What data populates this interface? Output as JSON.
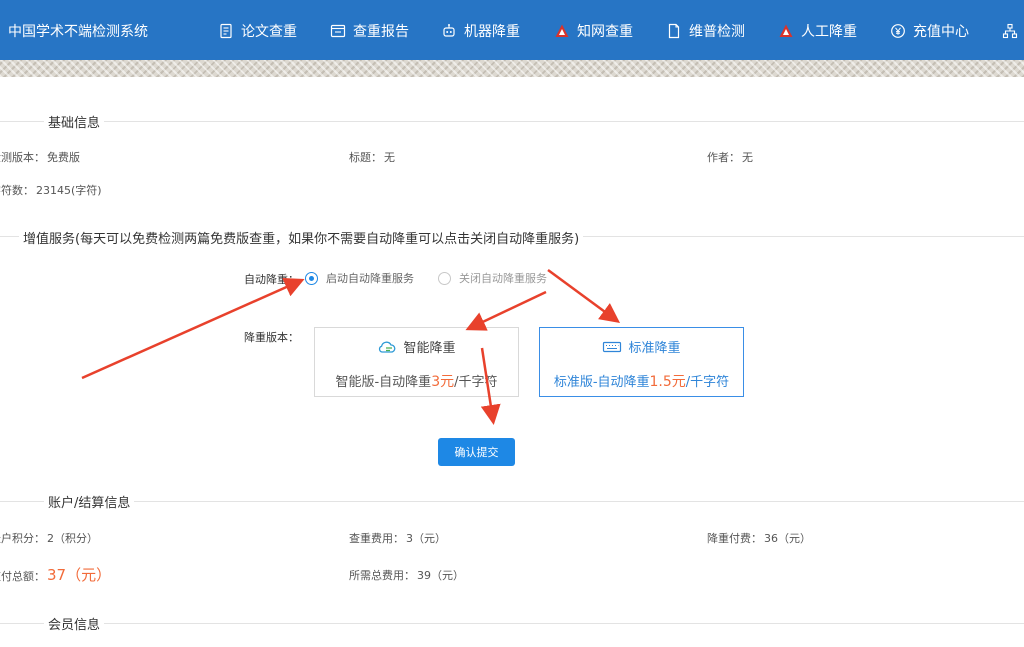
{
  "brand": "中国学术不端检测系统",
  "nav": [
    {
      "label": "论文查重",
      "icon": "document-icon"
    },
    {
      "label": "查重报告",
      "icon": "report-icon"
    },
    {
      "label": "机器降重",
      "icon": "robot-icon"
    },
    {
      "label": "知网查重",
      "icon": "cnki-logo-icon"
    },
    {
      "label": "维普检测",
      "icon": "file-icon"
    },
    {
      "label": "人工降重",
      "icon": "cnki-logo-icon"
    },
    {
      "label": "充值中心",
      "icon": "yen-coin-icon"
    }
  ],
  "basic": {
    "title": "基础信息",
    "version_label": "检测版本：",
    "version_value": "免费版",
    "title_label": "标题：",
    "title_value": "无",
    "author_label": "作者：",
    "author_value": "无",
    "chars_label": "字符数：",
    "chars_value": "23145(字符)"
  },
  "service": {
    "title": "增值服务(每天可以免费检测两篇免费版查重，如果你不需要自动降重可以点击关闭自动降重服务)",
    "auto_label": "自动降重：",
    "option_on": "启动自动降重服务",
    "option_off": "关闭自动降重服务",
    "selected_option": "启动自动降重服务",
    "version_label": "降重版本：",
    "smart": {
      "name": "智能降重",
      "desc_prefix": "智能版-自动降重",
      "price": "3元",
      "unit": "/千字符"
    },
    "standard": {
      "name": "标准降重",
      "desc_prefix": "标准版-自动降重",
      "price": "1.5元",
      "unit": "/千字符"
    },
    "selected_version": "标准降重",
    "submit": "确认提交"
  },
  "account": {
    "title": "账户/结算信息",
    "points_label": "账户积分：",
    "points_value": "2（积分）",
    "check_fee_label": "查重费用：",
    "check_fee_value": "3（元）",
    "reduce_fee_label": "降重付费：",
    "reduce_fee_value": "36（元）",
    "total_pay_label": "应付总额：",
    "total_pay_value": "37（元）",
    "total_need_label": "所需总费用：",
    "total_need_value": "39（元）"
  },
  "member": {
    "title": "会员信息"
  },
  "colors": {
    "nav_bg": "#2775c5",
    "primary": "#1e88e5",
    "price": "#f26b3a",
    "arrow": "#e8412c"
  }
}
